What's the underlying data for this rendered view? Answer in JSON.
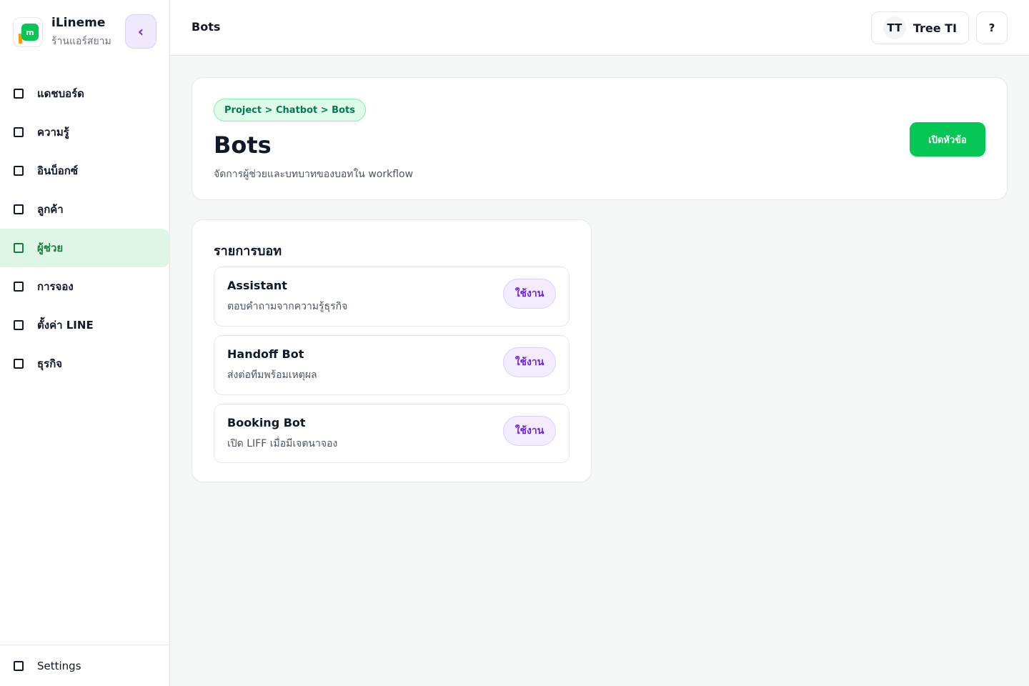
{
  "app": {
    "name": "iLineme",
    "shop_name": "ร้านแอร์สยาม",
    "logo_letter": "m",
    "collapse_glyph": "‹"
  },
  "sidebar": {
    "items": [
      {
        "label": "แดชบอร์ด",
        "icon": "square-icon",
        "active": false
      },
      {
        "label": "ความรู้",
        "icon": "square-icon",
        "active": false
      },
      {
        "label": "อินบ็อกซ์",
        "icon": "square-icon",
        "active": false
      },
      {
        "label": "ลูกค้า",
        "icon": "square-icon",
        "active": false
      },
      {
        "label": "ผู้ช่วย",
        "icon": "square-icon",
        "active": true
      },
      {
        "label": "การจอง",
        "icon": "square-icon",
        "active": false
      },
      {
        "label": "ตั้งค่า LINE",
        "icon": "square-icon",
        "active": false
      },
      {
        "label": "ธุรกิจ",
        "icon": "square-icon",
        "active": false
      }
    ],
    "footer_label": "Settings"
  },
  "topbar": {
    "title": "Bots",
    "user_initials": "TT",
    "user_name": "Tree TI",
    "help_label": "?"
  },
  "header": {
    "breadcrumb": "Project > Chatbot > Bots",
    "title": "Bots",
    "description": "จัดการผู้ช่วยและบทบาทของบอทใน workflow",
    "action_label": "เปิดหัวข้อ"
  },
  "bots": {
    "title": "รายการบอท",
    "items": [
      {
        "name": "Assistant",
        "description": "ตอบคำถามจากความรู้ธุรกิจ",
        "status": "ใช้งาน"
      },
      {
        "name": "Handoff Bot",
        "description": "ส่งต่อทีมพร้อมเหตุผล",
        "status": "ใช้งาน"
      },
      {
        "name": "Booking Bot",
        "description": "เปิด LIFF เมื่อมีเจตนาจอง",
        "status": "ใช้งาน"
      }
    ]
  },
  "colors": {
    "accent": "#06c755",
    "active_bg": "#dff5e6",
    "active_text": "#15803d",
    "badge_bg": "#f3ebff",
    "badge_text": "#6d28d9"
  }
}
